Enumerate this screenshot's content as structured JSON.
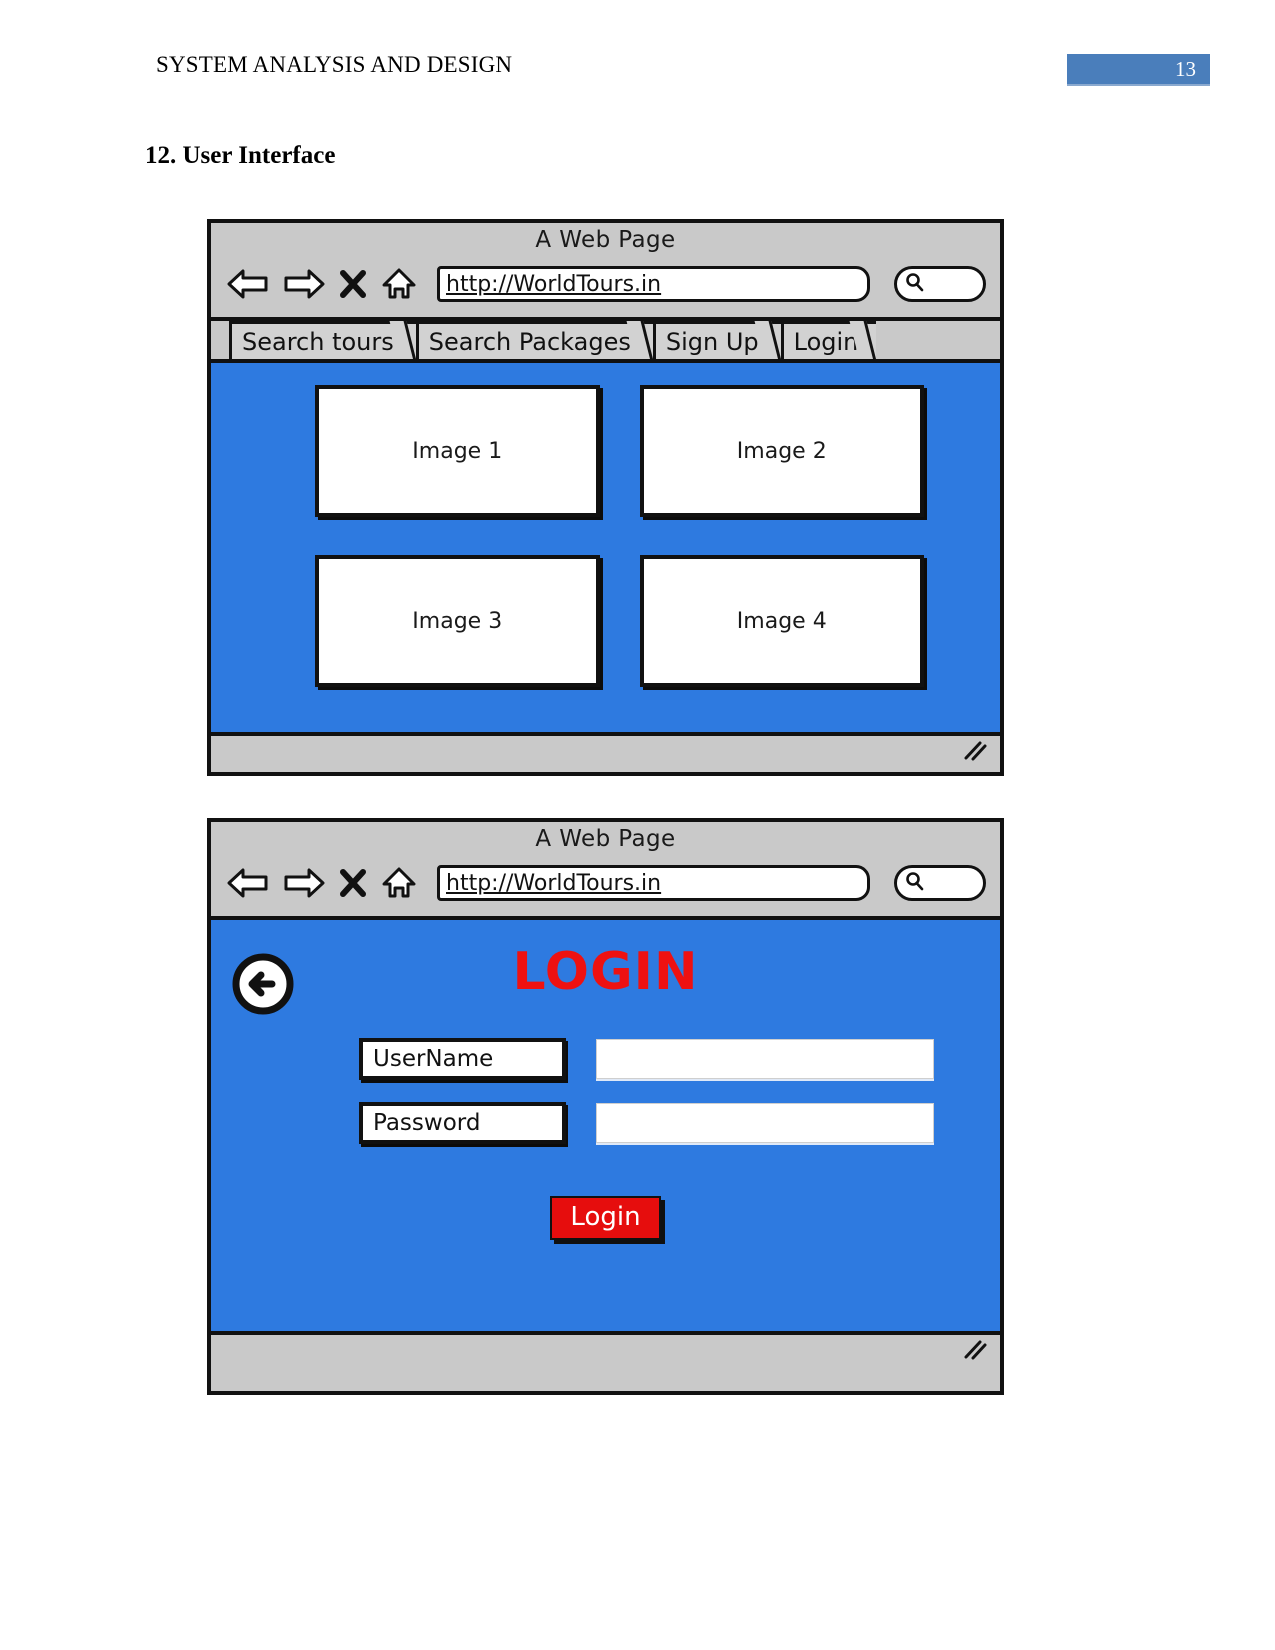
{
  "document": {
    "running_head": "SYSTEM ANALYSIS AND DESIGN",
    "page_number": "13",
    "section_heading": "12. User Interface",
    "badge_color": "#4a7ebb"
  },
  "mockups": [
    {
      "name": "home-page-mockup",
      "chrome": {
        "window_title": "A Web Page",
        "url": "http://WorldTours.in",
        "icons": [
          "back-arrow-icon",
          "forward-arrow-icon",
          "stop-x-icon",
          "home-icon",
          "search-icon"
        ]
      },
      "tabs": [
        {
          "label": "Search tours"
        },
        {
          "label": "Search Packages"
        },
        {
          "label": "Sign Up"
        },
        {
          "label": "Login"
        }
      ],
      "content": {
        "background_color": "#2e7ae0",
        "images": [
          {
            "label": "Image 1"
          },
          {
            "label": "Image 2"
          },
          {
            "label": "Image 3"
          },
          {
            "label": "Image 4"
          }
        ]
      }
    },
    {
      "name": "login-page-mockup",
      "chrome": {
        "window_title": "A Web Page",
        "url": "http://WorldTours.in",
        "icons": [
          "back-arrow-icon",
          "forward-arrow-icon",
          "stop-x-icon",
          "home-icon",
          "search-icon"
        ]
      },
      "content": {
        "background_color": "#2e7ae0",
        "back_button_icon": "circle-back-arrow-icon",
        "heading": "LOGIN",
        "heading_color": "#ee1111",
        "fields": [
          {
            "label": "UserName",
            "value": "",
            "placeholder": ""
          },
          {
            "label": "Password",
            "value": "",
            "placeholder": ""
          }
        ],
        "submit_label": "Login",
        "submit_color": "#e60d0d"
      }
    }
  ]
}
